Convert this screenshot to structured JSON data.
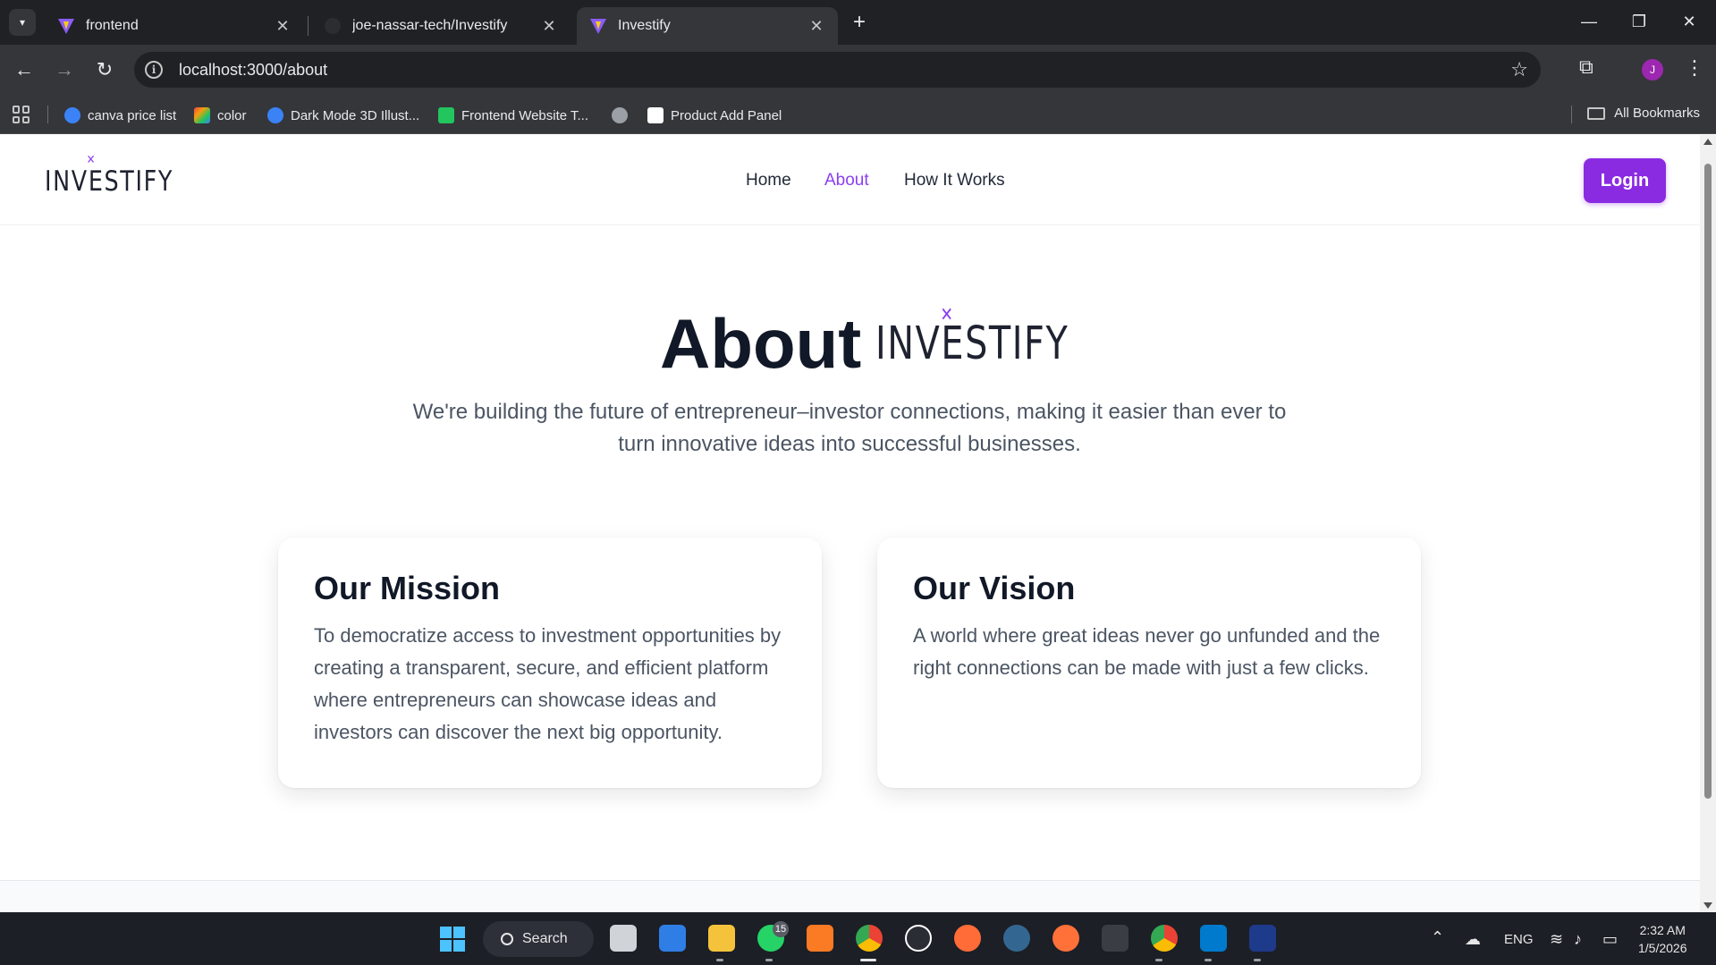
{
  "browser": {
    "tabs": [
      {
        "title": "frontend",
        "active": false
      },
      {
        "title": "joe-nassar-tech/Investify",
        "active": false
      },
      {
        "title": "Investify",
        "active": true
      }
    ],
    "url": "localhost:3000/about",
    "profile_initial": "J",
    "bookmarks": [
      {
        "label": "canva price list",
        "color": "#3b82f6"
      },
      {
        "label": "color",
        "color": "#f59e0b"
      },
      {
        "label": "Dark Mode 3D Illust...",
        "color": "#3b82f6"
      },
      {
        "label": "Frontend Website T...",
        "color": "#22c55e"
      },
      {
        "label": "",
        "color": "#9aa0a6"
      },
      {
        "label": "Product Add Panel",
        "color": "#ffffff"
      }
    ],
    "all_bookmarks": "All Bookmarks"
  },
  "site": {
    "logo": {
      "text": "INVESTIFY",
      "accent": "#8a3ff0"
    },
    "nav": [
      {
        "label": "Home",
        "active": false
      },
      {
        "label": "About",
        "active": true
      },
      {
        "label": "How It Works",
        "active": false
      }
    ],
    "login_label": "Login",
    "accent_color": "#8a2be2"
  },
  "hero": {
    "title": "About",
    "logo_text": "INVESTIFY",
    "subtitle": "We're building the future of entrepreneur–investor connections, making it easier than ever to turn innovative ideas into successful businesses."
  },
  "cards": [
    {
      "title": "Our Mission",
      "body": "To democratize access to investment opportunities by creating a transparent, secure, and efficient platform where entrepreneurs can showcase ideas and investors can discover the next big opportunity."
    },
    {
      "title": "Our Vision",
      "body": "A world where great ideas never go unfunded and the right connections can be made with just a few clicks."
    }
  ],
  "taskbar": {
    "search_label": "Search",
    "whatsapp_badge": "15",
    "language": "ENG",
    "time": "2:32 AM",
    "date": "1/5/2026"
  }
}
